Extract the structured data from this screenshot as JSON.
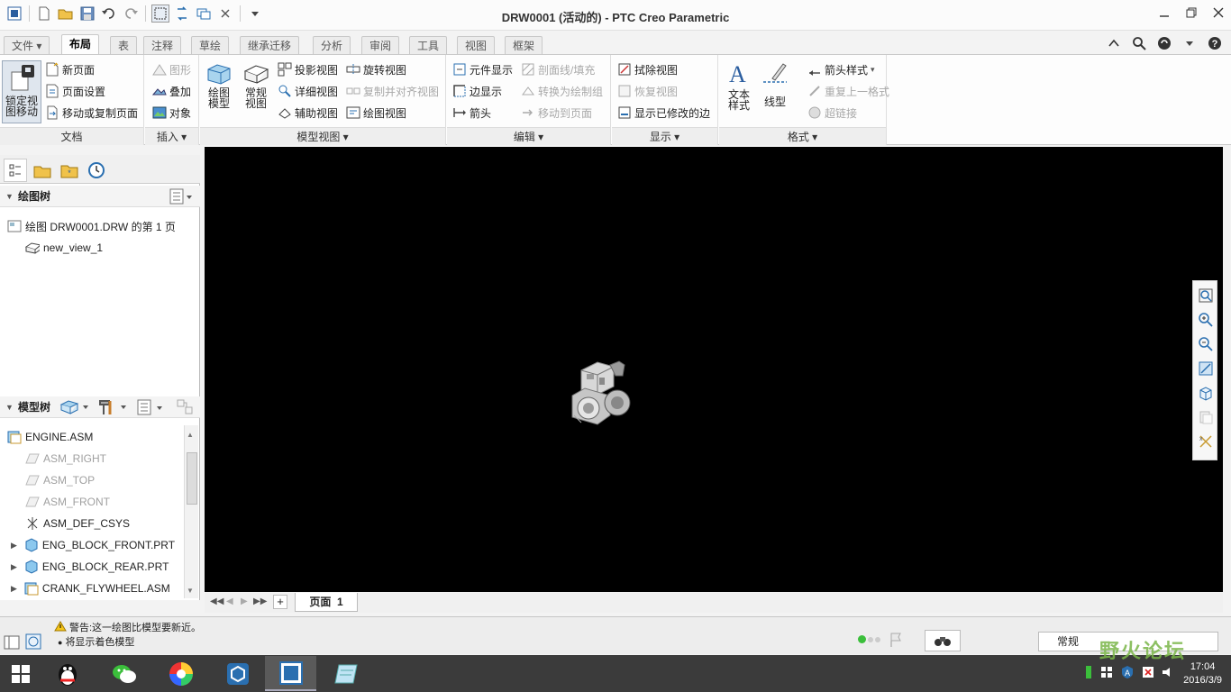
{
  "window": {
    "title": "DRW0001 (活动的) - PTC Creo Parametric"
  },
  "tabs": [
    "文件",
    "布局",
    "表",
    "注释",
    "草绘",
    "继承迁移",
    "分析",
    "审阅",
    "工具",
    "视图",
    "框架"
  ],
  "active_tab": "布局",
  "ribbon": {
    "doc": {
      "lock_label_1": "锁定视",
      "lock_label_2": "图移动",
      "new_page": "新页面",
      "page_setup": "页面设置",
      "move_copy_page": "移动或复制页面",
      "group": "文档"
    },
    "insert": {
      "graphic": "图形",
      "overlay": "叠加",
      "object": "对象",
      "group": "插入"
    },
    "model_views": {
      "drawing_model_1": "绘图",
      "drawing_model_2": "模型",
      "general_view_1": "常规",
      "general_view_2": "视图",
      "projection": "投影视图",
      "detailed": "详细视图",
      "auxiliary": "辅助视图",
      "revolved": "旋转视图",
      "copy_align": "复制并对齐视图",
      "drawing_view": "绘图视图",
      "group": "模型视图"
    },
    "edit": {
      "element_display": "元件显示",
      "edge_display": "边显示",
      "arrow": "箭头",
      "hatch_fill": "剖面线/填充",
      "convert_group": "转换为绘制组",
      "move_to_page": "移动到页面",
      "group": "编辑"
    },
    "display": {
      "erase_view": "拭除视图",
      "resume_view": "恢复视图",
      "show_modified_edges": "显示已修改的边",
      "group": "显示"
    },
    "format": {
      "text_style_1": "文本",
      "text_style_2": "样式",
      "line_style": "线型",
      "arrow_style": "箭头样式",
      "repeat_format": "重复上一格式",
      "hyperlink": "超链接",
      "group": "格式"
    }
  },
  "drawing_tree": {
    "title": "绘图树",
    "items": [
      "绘图 DRW0001.DRW 的第 1 页",
      "new_view_1"
    ]
  },
  "model_tree": {
    "title": "模型树",
    "root": "ENGINE.ASM",
    "items": [
      {
        "label": "ASM_RIGHT",
        "state": "datum"
      },
      {
        "label": "ASM_TOP",
        "state": "datum"
      },
      {
        "label": "ASM_FRONT",
        "state": "datum"
      },
      {
        "label": "ASM_DEF_CSYS",
        "state": "csys"
      },
      {
        "label": "ENG_BLOCK_FRONT.PRT",
        "state": "part"
      },
      {
        "label": "ENG_BLOCK_REAR.PRT",
        "state": "part"
      },
      {
        "label": "CRANK_FLYWHEEL.ASM",
        "state": "asm"
      }
    ]
  },
  "page_tab": {
    "label": "页面",
    "number": "1"
  },
  "status": {
    "warning": "警告:这一绘图比模型要新近。",
    "info": "将显示着色模型",
    "filter": "常规"
  },
  "taskbar": {
    "time": "17:04",
    "date": "2016/3/9"
  },
  "watermark": "野火论坛",
  "colors": {
    "graphics_bg": "#000000",
    "accent": "#2f7fbf"
  }
}
